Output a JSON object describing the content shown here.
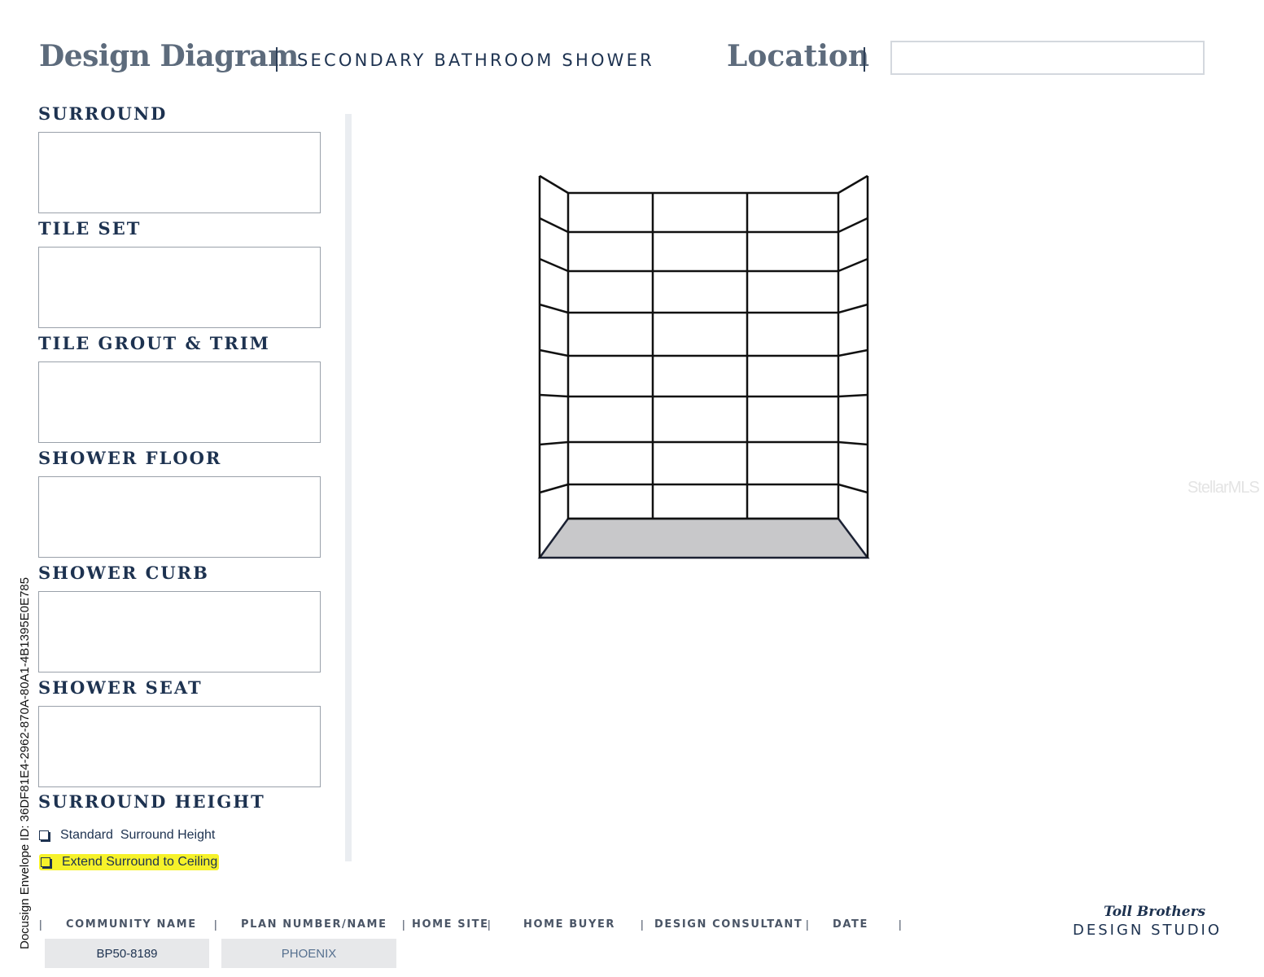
{
  "header": {
    "title": "Design Diagram",
    "subtitle": "SECONDARY BATHROOM SHOWER",
    "location_label": "Location",
    "location_value": ""
  },
  "sections": [
    {
      "label": "SURROUND",
      "value": ""
    },
    {
      "label": "TILE SET",
      "value": ""
    },
    {
      "label": "TILE GROUT & TRIM",
      "value": ""
    },
    {
      "label": "SHOWER FLOOR",
      "value": ""
    },
    {
      "label": "SHOWER CURB",
      "value": ""
    },
    {
      "label": "SHOWER SEAT",
      "value": ""
    }
  ],
  "surround_height": {
    "label": "SURROUND HEIGHT",
    "options": [
      {
        "label": "Standard  Surround Height",
        "highlighted": false
      },
      {
        "label": "Extend Surround to Ceiling",
        "highlighted": true
      }
    ]
  },
  "side_id": "Docusign Envelope ID: 36DF81E4-2962-870A-80A1-4B1395E0E785",
  "watermark": "StellarMLS",
  "footer": {
    "labels": [
      "COMMUNITY NAME",
      "PLAN NUMBER/NAME",
      "HOME SITE",
      "HOME BUYER",
      "DESIGN CONSULTANT",
      "DATE"
    ],
    "values": {
      "community_name": "BP50-8189",
      "plan_number": "PHOENIX"
    },
    "logo_top": "Toll Brothers",
    "logo_bottom": "DESIGN STUDIO"
  },
  "colors": {
    "navy": "#1d3250",
    "slate": "#5d6b7c",
    "highlight": "#f6f22a",
    "floor_fill": "#c8c8ca"
  }
}
